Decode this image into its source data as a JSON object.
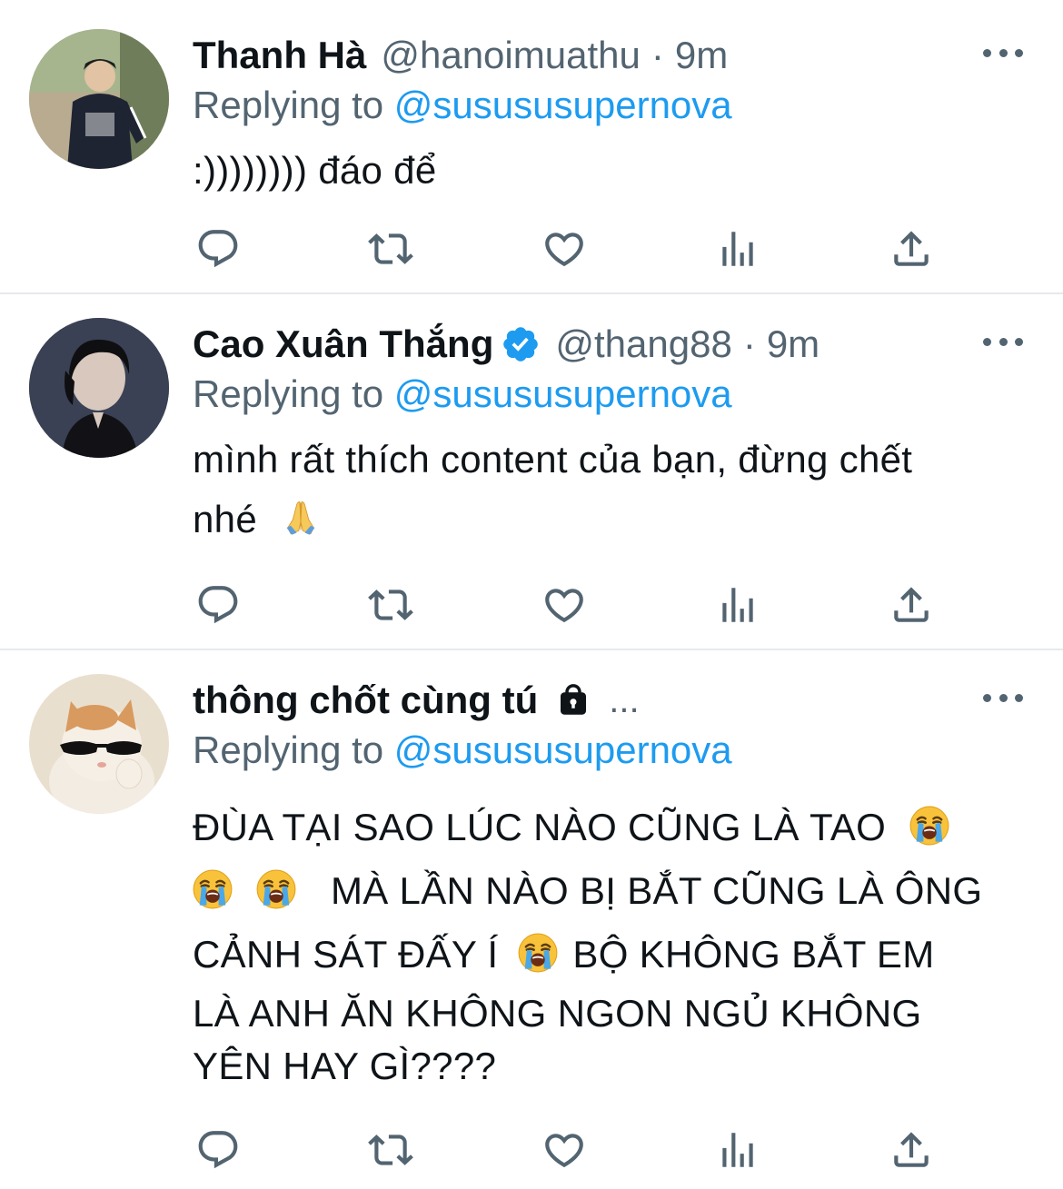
{
  "tweets": [
    {
      "display_name": "Thanh Hà",
      "handle": "@hanoimuathu",
      "separator": "·",
      "time": "9m",
      "replying_prefix": "Replying to",
      "replying_to": "@susususupernova",
      "text": ":)))))))) đáo để"
    },
    {
      "display_name": "Cao Xuân Thắng",
      "verified": true,
      "handle": "@thang88",
      "separator": "·",
      "time": "9m",
      "replying_prefix": "Replying to",
      "replying_to": "@susususupernova",
      "text_line1": "mình rất thích content của bạn, đừng chết",
      "text_line2": "nhé",
      "emoji": "folded-hands-emoji"
    },
    {
      "display_name": "thông chốt cùng tú",
      "protected": true,
      "truncated": "...",
      "replying_prefix": "Replying to",
      "replying_to": "@susususupernova",
      "line1": "ĐÙA TẠI SAO LÚC NÀO CŨNG LÀ TAO",
      "line2": "MÀ LẦN NÀO BỊ BẮT CŨNG LÀ ÔNG",
      "line3a": "CẢNH SÁT ĐẤY Í",
      "line3b": "BỘ KHÔNG BẮT EM",
      "line4": "LÀ ANH ĂN KHÔNG NGON NGỦ KHÔNG",
      "line5": "YÊN HAY GÌ????",
      "emoji": "loudly-crying-face-emoji"
    }
  ],
  "action_icons": [
    "reply-icon",
    "retweet-icon",
    "like-icon",
    "analytics-icon",
    "share-icon"
  ],
  "colors": {
    "text": "#0f1419",
    "secondary": "#536471",
    "link": "#1d9bf0",
    "divider": "#e6e9ec",
    "verified": "#1d9bf0"
  }
}
